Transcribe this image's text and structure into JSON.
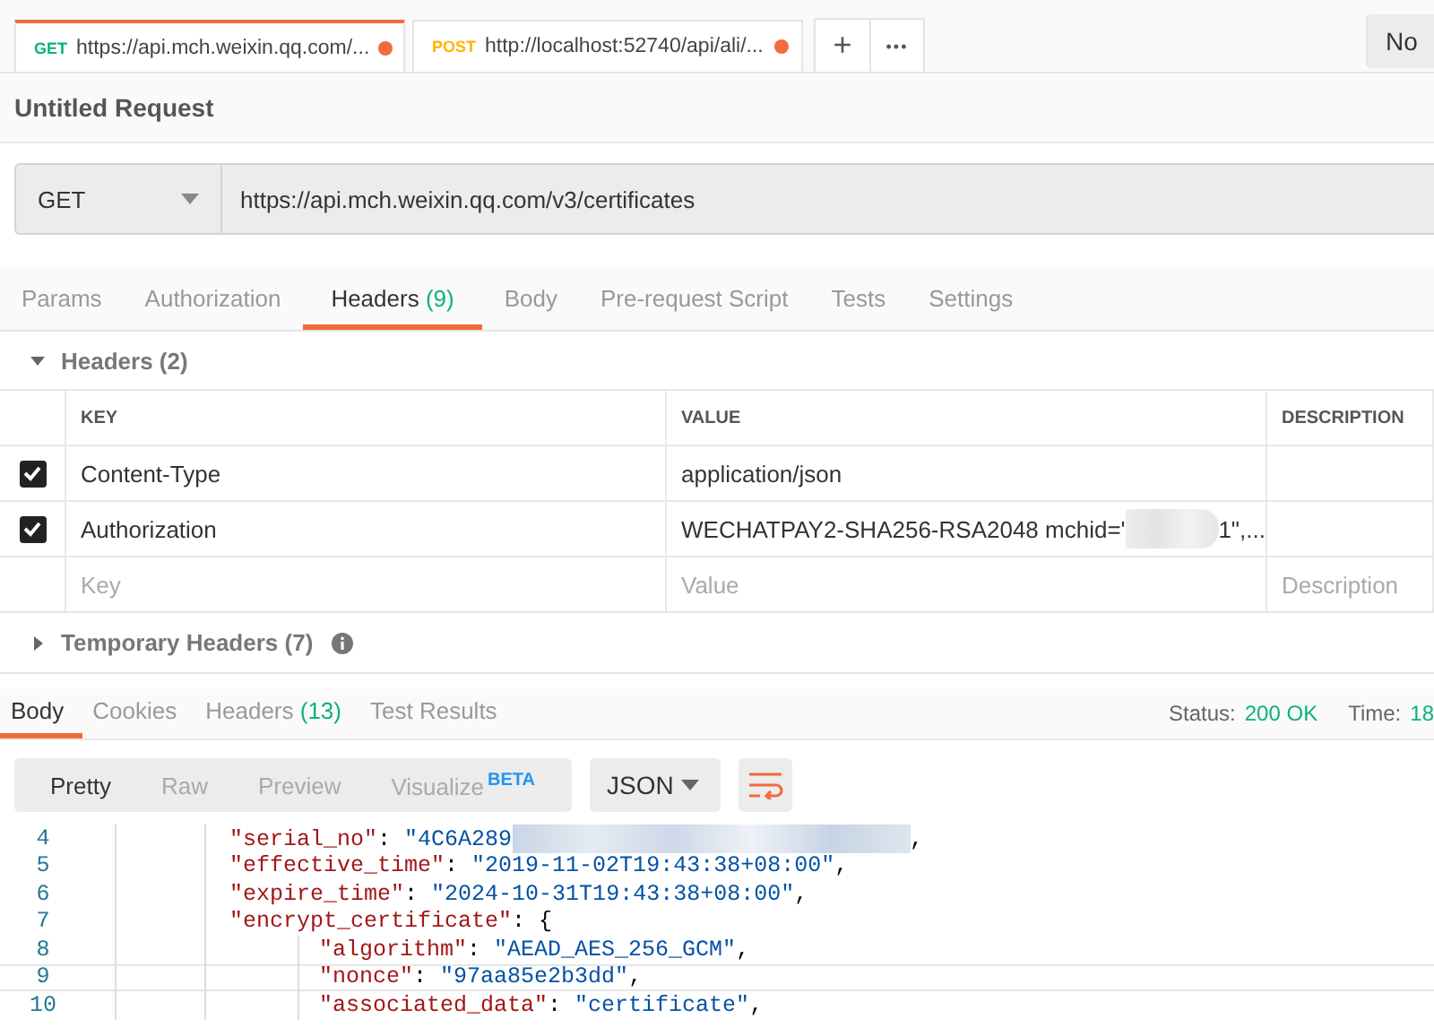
{
  "tabs": [
    {
      "method": "GET",
      "url": "https://api.mch.weixin.qq.com/...",
      "selected": true,
      "unsaved": true
    },
    {
      "method": "POST",
      "url": "http://localhost:52740/api/ali/...",
      "selected": false,
      "unsaved": true
    }
  ],
  "new_tab": "+",
  "more_tabs": "•••",
  "environment": "No",
  "request_name": "Untitled Request",
  "request": {
    "method": "GET",
    "url": "https://api.mch.weixin.qq.com/v3/certificates"
  },
  "request_tabs": [
    {
      "label": "Params",
      "selected": false
    },
    {
      "label": "Authorization",
      "selected": false
    },
    {
      "label": "Headers",
      "count": "(9)",
      "selected": true
    },
    {
      "label": "Body",
      "selected": false
    },
    {
      "label": "Pre-request Script",
      "selected": false
    },
    {
      "label": "Tests",
      "selected": false
    },
    {
      "label": "Settings",
      "selected": false
    }
  ],
  "headers_section": {
    "title": "Headers (2)",
    "expanded": true
  },
  "table": {
    "columns": [
      "KEY",
      "VALUE",
      "DESCRIPTION"
    ],
    "rows": [
      {
        "key": "Content-Type",
        "value": "application/json",
        "checked": true,
        "redacted": false
      },
      {
        "key": "Authorization",
        "value": "WECHATPAY2-SHA256-RSA2048 mchid='",
        "checked": true,
        "redacted": true,
        "value_tail": "1\",..."
      }
    ],
    "new_row": {
      "key": {
        "placeholder": "Key"
      },
      "value": {
        "placeholder": "Value"
      },
      "description": {
        "placeholder": "Description"
      }
    }
  },
  "temporary_headers": {
    "title": "Temporary Headers (7)",
    "expanded": false
  },
  "response_tabs": [
    {
      "label": "Body",
      "selected": true
    },
    {
      "label": "Cookies",
      "selected": false
    },
    {
      "label": "Headers",
      "count": "(13)",
      "selected": false
    },
    {
      "label": "Test Results",
      "selected": false
    }
  ],
  "status": {
    "label": "Status:",
    "value": "200 OK",
    "time_label": "Time:",
    "time_value": "18"
  },
  "view_modes": [
    {
      "label": "Pretty",
      "selected": true
    },
    {
      "label": "Raw",
      "selected": false
    },
    {
      "label": "Preview",
      "selected": false
    },
    {
      "label": "Visualize",
      "badge": "BETA",
      "selected": false
    }
  ],
  "format": "JSON",
  "code_lines": [
    {
      "number": "4",
      "key": "\"serial_no\"",
      "separator": ":",
      "value": "\"4C6A289",
      "redacted": true,
      "tail": ",",
      "current": false
    },
    {
      "number": "5",
      "key": "\"effective_time\"",
      "separator": ":",
      "value": "\"2019-11-02T19:43:38+08:00\"",
      "redacted": false,
      "tail": ",",
      "current": false
    },
    {
      "number": "6",
      "key": "\"expire_time\"",
      "separator": ":",
      "value": "\"2024-10-31T19:43:38+08:00\"",
      "redacted": false,
      "tail": ",",
      "current": false
    },
    {
      "number": "7",
      "key": "\"encrypt_certificate\"",
      "separator": ":",
      "redacted": false,
      "tail": "{",
      "current": false,
      "children": [
        {
          "number": "8",
          "key": "\"algorithm\"",
          "separator": ":",
          "value": "\"AEAD_AES_256_GCM\"",
          "redacted": false,
          "tail": ",",
          "current": false
        },
        {
          "number": "9",
          "key": "\"nonce\"",
          "separator": ":",
          "value": "\"97aa85e2b3dd\"",
          "redacted": false,
          "tail": ",",
          "current": true
        },
        {
          "number": "10",
          "key": "\"associated_data\"",
          "separator": ":",
          "value": "\"certificate\"",
          "redacted": false,
          "tail": ",",
          "current": false
        }
      ]
    }
  ]
}
